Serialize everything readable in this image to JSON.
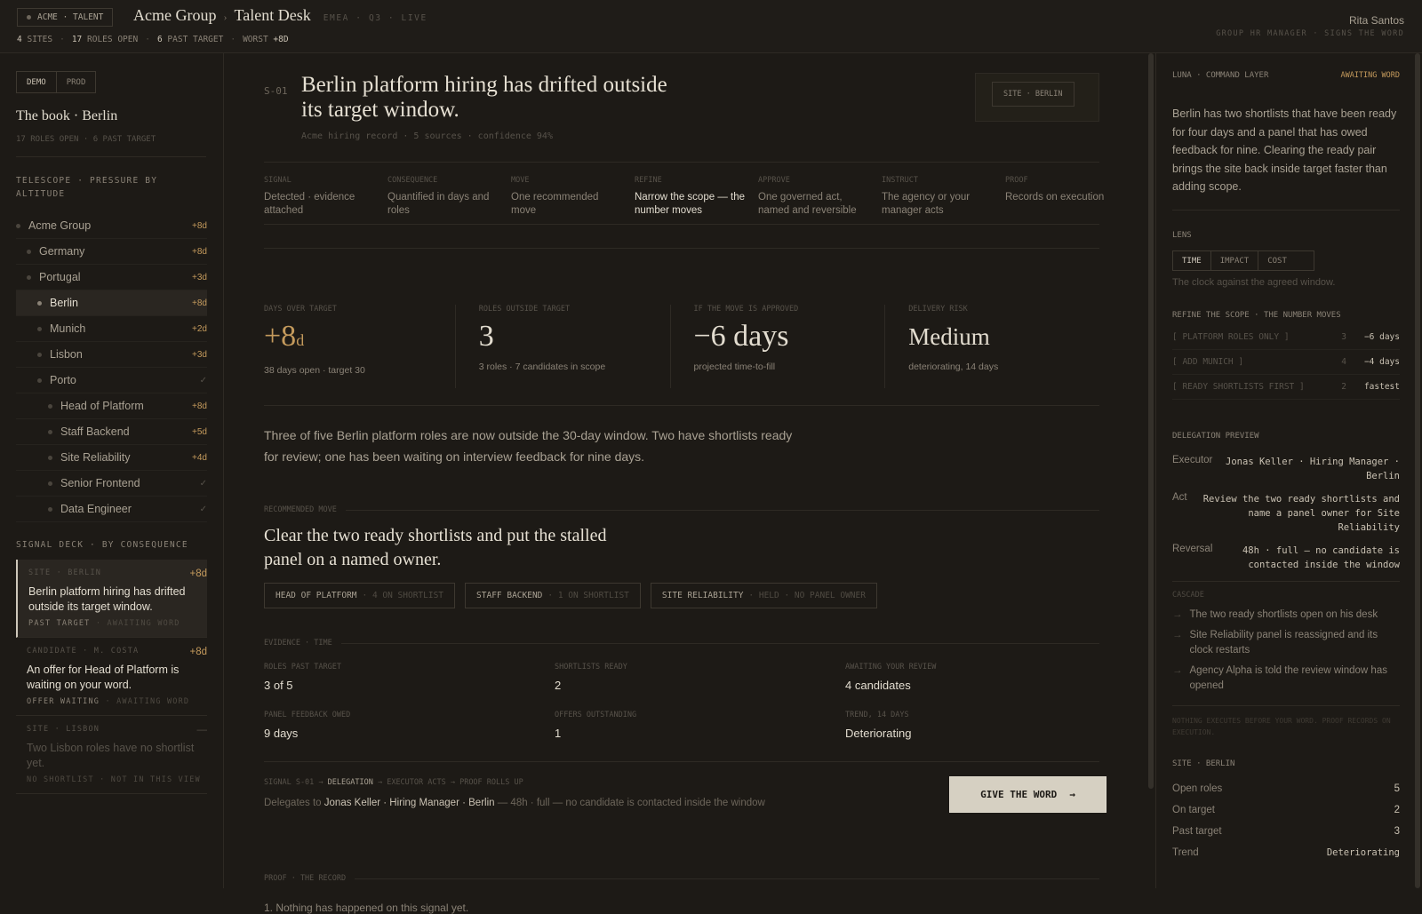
{
  "topbar": {
    "chip": "ACME · TALENT",
    "org": "Acme Group",
    "sep": "›",
    "app": "Talent Desk",
    "meta": "EMEA · Q3 · LIVE",
    "stats": [
      {
        "n": "4",
        "l": "SITES"
      },
      {
        "n": "17",
        "l": "ROLES OPEN"
      },
      {
        "n": "6",
        "l": "PAST TARGET"
      },
      {
        "n": "WORST",
        "l": "+8D"
      }
    ],
    "user_name": "Rita Santos",
    "user_role": "GROUP HR MANAGER · SIGNS THE WORD"
  },
  "left": {
    "toggle": [
      "DEMO",
      "PROD"
    ],
    "book_title": "The book · Berlin",
    "book_sub": "17 ROLES OPEN · 6 PAST TARGET",
    "telescope_label": "TELESCOPE · PRESSURE BY ALTITUDE",
    "tree": [
      {
        "label": "Acme Group",
        "value": "+8d"
      },
      {
        "label": "Germany",
        "value": "+8d"
      },
      {
        "label": "Portugal",
        "value": "+3d"
      },
      {
        "label": "Berlin",
        "value": "+8d"
      },
      {
        "label": "Munich",
        "value": "+2d"
      },
      {
        "label": "Lisbon",
        "value": "+3d"
      },
      {
        "label": "Porto",
        "value": "✓"
      },
      {
        "label": "Head of Platform",
        "value": "+8d"
      },
      {
        "label": "Staff Backend",
        "value": "+5d"
      },
      {
        "label": "Site Reliability",
        "value": "+4d"
      },
      {
        "label": "Senior Frontend",
        "value": "✓"
      },
      {
        "label": "Data Engineer",
        "value": "✓"
      }
    ],
    "deck_label": "SIGNAL DECK · BY CONSEQUENCE",
    "cards": [
      {
        "kicker": "SITE · BERLIN",
        "amount": "+8d",
        "text": "Berlin platform hiring has drifted outside its target window.",
        "foot1": "PAST TARGET",
        "foot2": "· AWAITING WORD"
      },
      {
        "kicker": "CANDIDATE · M. COSTA",
        "amount": "+8d",
        "text": "An offer for Head of Platform is waiting on your word.",
        "foot1": "OFFER WAITING",
        "foot2": "· AWAITING WORD"
      },
      {
        "kicker": "SITE · LISBON",
        "amount": "—",
        "text": "Two Lisbon roles have no shortlist yet.",
        "foot1": "NO SHORTLIST",
        "foot2": "· NOT IN THIS VIEW"
      }
    ]
  },
  "main": {
    "sid": "S-01",
    "title": "Berlin platform hiring has drifted outside its target window.",
    "subtitle": "Acme hiring record · 5 sources · confidence 94%",
    "site_chip": "SITE · BERLIN",
    "steps": [
      {
        "k": "SIGNAL",
        "v": "Detected · evidence attached"
      },
      {
        "k": "CONSEQUENCE",
        "v": "Quantified in days and roles"
      },
      {
        "k": "MOVE",
        "v": "One recommended move"
      },
      {
        "k": "REFINE",
        "v": "Narrow the scope — the number moves"
      },
      {
        "k": "APPROVE",
        "v": "One governed act, named and reversible"
      },
      {
        "k": "INSTRUCT",
        "v": "The agency or your manager acts"
      },
      {
        "k": "PROOF",
        "v": "Records on execution"
      }
    ],
    "metrics": [
      {
        "k": "DAYS OVER TARGET",
        "v": "+8",
        "unit": "d",
        "sub": "38 days open · target 30"
      },
      {
        "k": "ROLES OUTSIDE TARGET",
        "v": "3",
        "sub": "3 roles · 7 candidates in scope"
      },
      {
        "k": "IF THE MOVE IS APPROVED",
        "v": "−6 days",
        "sub": "projected time-to-fill"
      },
      {
        "k": "DELIVERY RISK",
        "v": "Medium",
        "sub": "deteriorating, 14 days"
      }
    ],
    "narrative": "Three of five Berlin platform roles are now outside the 30-day window. Two have shortlists ready for review; one has been waiting on interview feedback for nine days.",
    "rec_label": "RECOMMENDED MOVE",
    "move": "Clear the two ready shortlists and put the stalled panel on a named owner.",
    "chips": [
      {
        "a": "HEAD OF PLATFORM",
        "b": "· 4 ON SHORTLIST"
      },
      {
        "a": "STAFF BACKEND",
        "b": "· 1 ON SHORTLIST"
      },
      {
        "a": "SITE RELIABILITY",
        "b": "· HELD · NO PANEL OWNER"
      }
    ],
    "ev_label": "EVIDENCE · TIME",
    "evidence": [
      {
        "k": "ROLES PAST TARGET",
        "v": "3 of 5"
      },
      {
        "k": "SHORTLISTS READY",
        "v": "2"
      },
      {
        "k": "AWAITING YOUR REVIEW",
        "v": "4 candidates"
      },
      {
        "k": "PANEL FEEDBACK OWED",
        "v": "9 days"
      },
      {
        "k": "OFFERS OUTSTANDING",
        "v": "1"
      },
      {
        "k": "TREND, 14 DAYS",
        "v": "Deteriorating"
      }
    ],
    "deleg_kicker_a": "SIGNAL S-01 →",
    "deleg_kicker_b": "DELEGATION",
    "deleg_kicker_c": "→ EXECUTOR ACTS → PROOF ROLLS UP",
    "deleg_pre": "Delegates to",
    "deleg_name": "Jonas Keller · Hiring Manager · Berlin",
    "deleg_post": "— 48h · full — no candidate is contacted inside the window",
    "give_label": "GIVE THE WORD",
    "give_arrow": "→",
    "proof_label": "PROOF · THE RECORD",
    "proof_item": "Nothing has happened on this signal yet."
  },
  "right": {
    "luna_label": "LUNA · COMMAND LAYER",
    "luna_status": "AWAITING WORD",
    "luna_text": "Berlin has two shortlists that have been ready for four days and a panel that has owed feedback for nine. Clearing the ready pair brings the site back inside target faster than adding scope.",
    "lens_label": "LENS",
    "lens": [
      "TIME",
      "IMPACT",
      "COST"
    ],
    "lens_desc": "The clock against the agreed window.",
    "refine_label": "REFINE THE SCOPE · THE NUMBER MOVES",
    "refine": [
      {
        "a": "[ PLATFORM ROLES ONLY ]",
        "n": "3",
        "z": "−6 days"
      },
      {
        "a": "[ ADD MUNICH ]",
        "n": "4",
        "z": "−4 days"
      },
      {
        "a": "[ READY SHORTLISTS FIRST ]",
        "n": "2",
        "z": "fastest"
      }
    ],
    "deleg_label": "DELEGATION PREVIEW",
    "deleg": [
      {
        "l": "Executor",
        "r": "Jonas Keller · Hiring Manager · Berlin"
      },
      {
        "l": "Act",
        "r": "Review the two ready shortlists and name a panel owner for Site Reliability"
      },
      {
        "l": "Reversal",
        "r": "48h · full — no candidate is contacted inside the window"
      }
    ],
    "cascade_label": "CASCADE",
    "cascade": [
      "The two ready shortlists open on his desk",
      "Site Reliability panel is reassigned and its clock restarts",
      "Agency Alpha is told the review window has opened"
    ],
    "note": "NOTHING EXECUTES BEFORE YOUR WORD. PROOF RECORDS ON EXECUTION.",
    "site_label": "SITE · BERLIN",
    "stats": [
      {
        "l": "Open roles",
        "r": "5"
      },
      {
        "l": "On target",
        "r": "2"
      },
      {
        "l": "Past target",
        "r": "3"
      },
      {
        "l": "Trend",
        "r": "Deteriorating"
      }
    ]
  },
  "colors": {
    "accent": "#c49a5c",
    "background": "#1d1a16",
    "button": "#d6d0c2"
  }
}
